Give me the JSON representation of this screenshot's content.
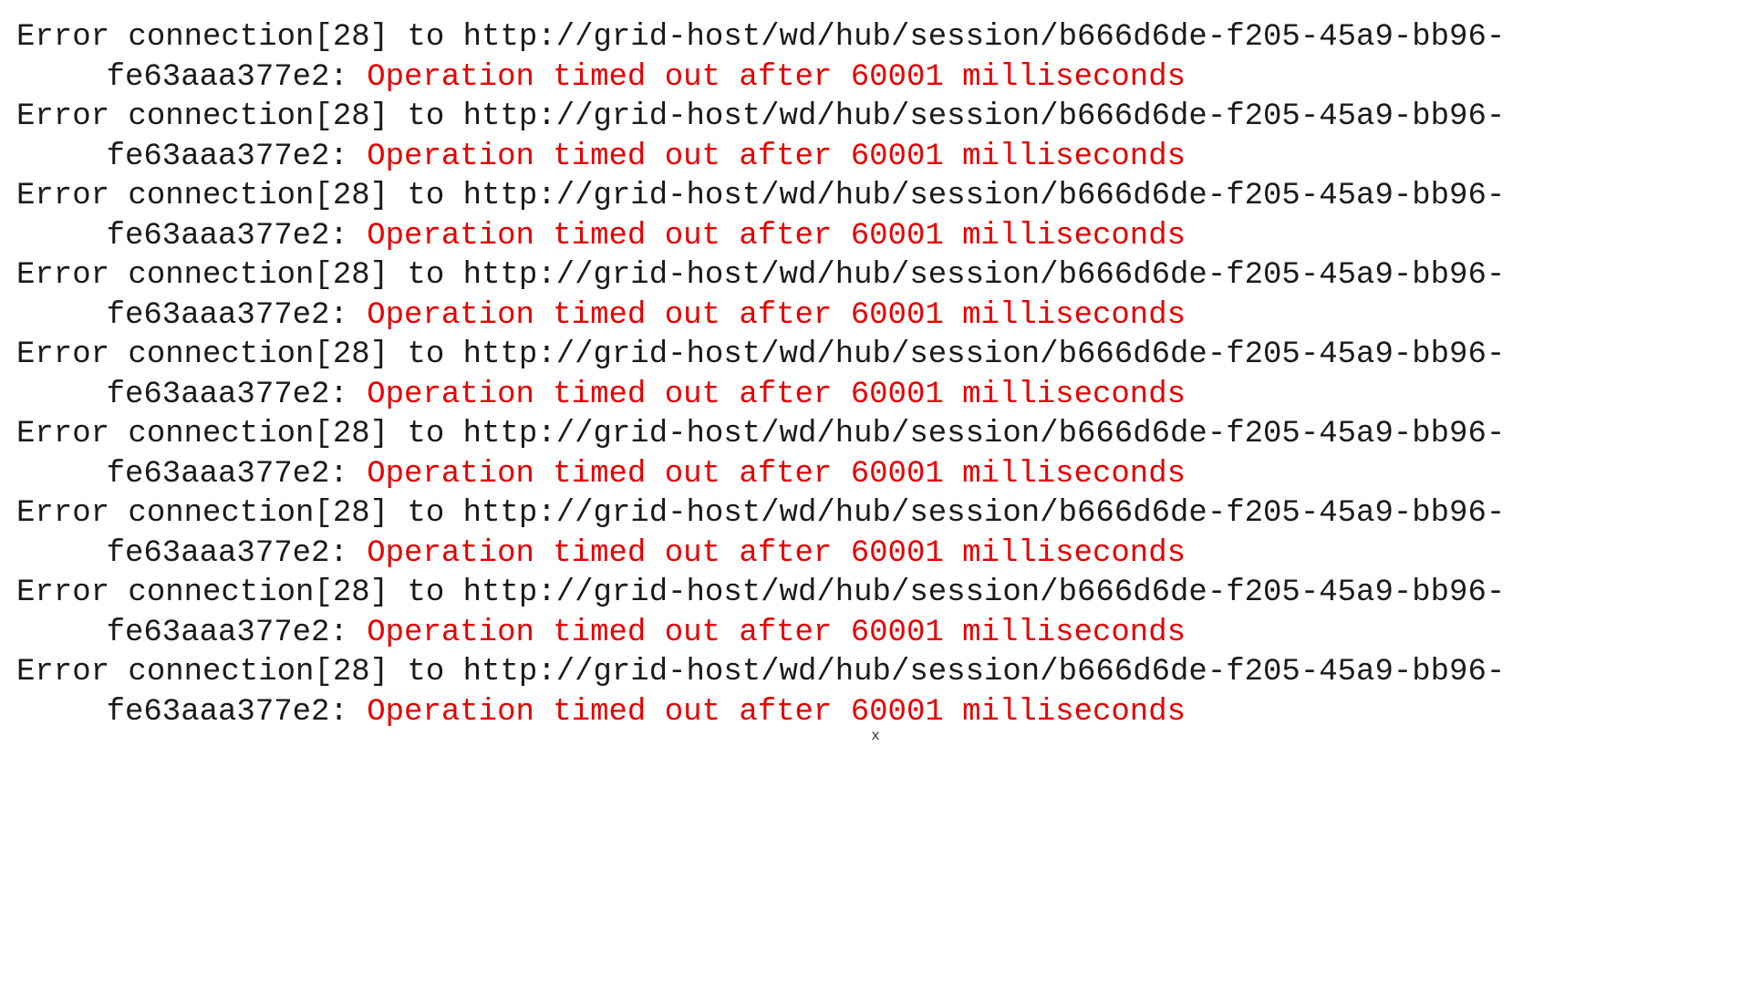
{
  "colors": {
    "text": "#1a1a1a",
    "error": "#e60000",
    "background": "#ffffff"
  },
  "log": {
    "prefix_text": "Error connection[28] to http://grid-host/wd/hub/session/b666d6de-f205-45a9-bb96-fe63aaa377e2: ",
    "error_text": "Operation timed out after 60001 milliseconds",
    "repeat_count": 9
  },
  "footer_mark": "x"
}
